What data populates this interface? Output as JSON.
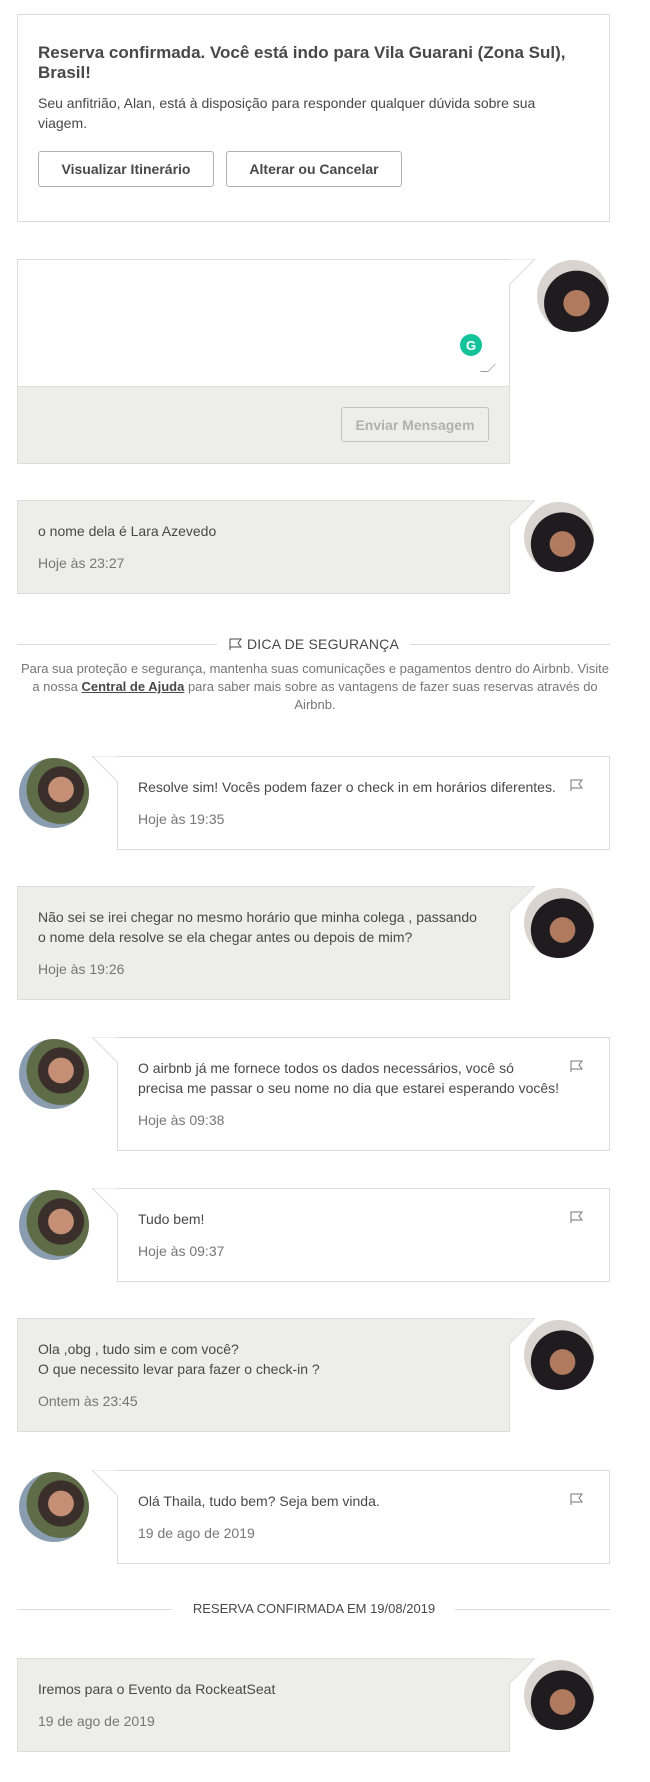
{
  "reservation": {
    "title": "Reserva confirmada. Você está indo para Vila Guarani (Zona Sul), Brasil!",
    "description": "Seu anfitrião, Alan, está à disposição para responder qualquer dúvida sobre sua viagem.",
    "view_itinerary": "Visualizar Itinerário",
    "change_cancel": "Alterar ou Cancelar"
  },
  "composer": {
    "placeholder": "",
    "grammarly_glyph": "G",
    "send_label": "Enviar Mensagem"
  },
  "safety": {
    "title": "DICA DE SEGURANÇA",
    "text_before": "Para sua proteção e segurança, mantenha suas comunicações e pagamentos dentro do Airbnb. Visite a nossa ",
    "link": "Central de Ajuda",
    "text_after": " para saber mais sobre as vantagens de fazer suas reservas através do Airbnb."
  },
  "messages": [
    {
      "from": "guest",
      "lines": [
        "o nome  dela é Lara Azevedo"
      ],
      "time": "Hoje às 23:27"
    },
    {
      "from": "host",
      "lines": [
        "Resolve sim! Vocês podem fazer o check in em horários diferentes."
      ],
      "time": "Hoje às 19:35"
    },
    {
      "from": "guest",
      "lines": [
        "Não sei se irei chegar no mesmo horário que minha colega , passando",
        "o nome dela resolve se ela chegar antes ou depois de mim?"
      ],
      "time": "Hoje às 19:26"
    },
    {
      "from": "host",
      "lines": [
        "O airbnb já me fornece todos os dados necessários, você só",
        "precisa me passar o seu nome no dia que estarei esperando vocês!"
      ],
      "time": "Hoje às 09:38"
    },
    {
      "from": "host",
      "lines": [
        "Tudo bem!"
      ],
      "time": "Hoje às 09:37"
    },
    {
      "from": "guest",
      "lines": [
        "Ola ,obg , tudo sim e com você?",
        "O que necessito levar para fazer o check-in ?"
      ],
      "time": "Ontem às 23:45"
    },
    {
      "from": "host",
      "lines": [
        "Olá Thaila, tudo bem? Seja bem vinda."
      ],
      "time": "19 de ago de 2019"
    },
    {
      "from": "guest",
      "lines": [
        "Iremos para o Evento da RockeatSeat"
      ],
      "time": "19 de ago de 2019"
    }
  ],
  "confirmed_divider": "RESERVA CONFIRMADA EM 19/08/2019",
  "icons": {
    "flag": "flag-icon",
    "grammarly": "grammarly-icon",
    "avatar_host": "avatar",
    "avatar_guest": "avatar"
  },
  "colors": {
    "text": "#484848",
    "muted": "#767676",
    "border": "#dcdcdc",
    "bubble_guest": "#edeeec",
    "grammarly": "#15c39a"
  }
}
